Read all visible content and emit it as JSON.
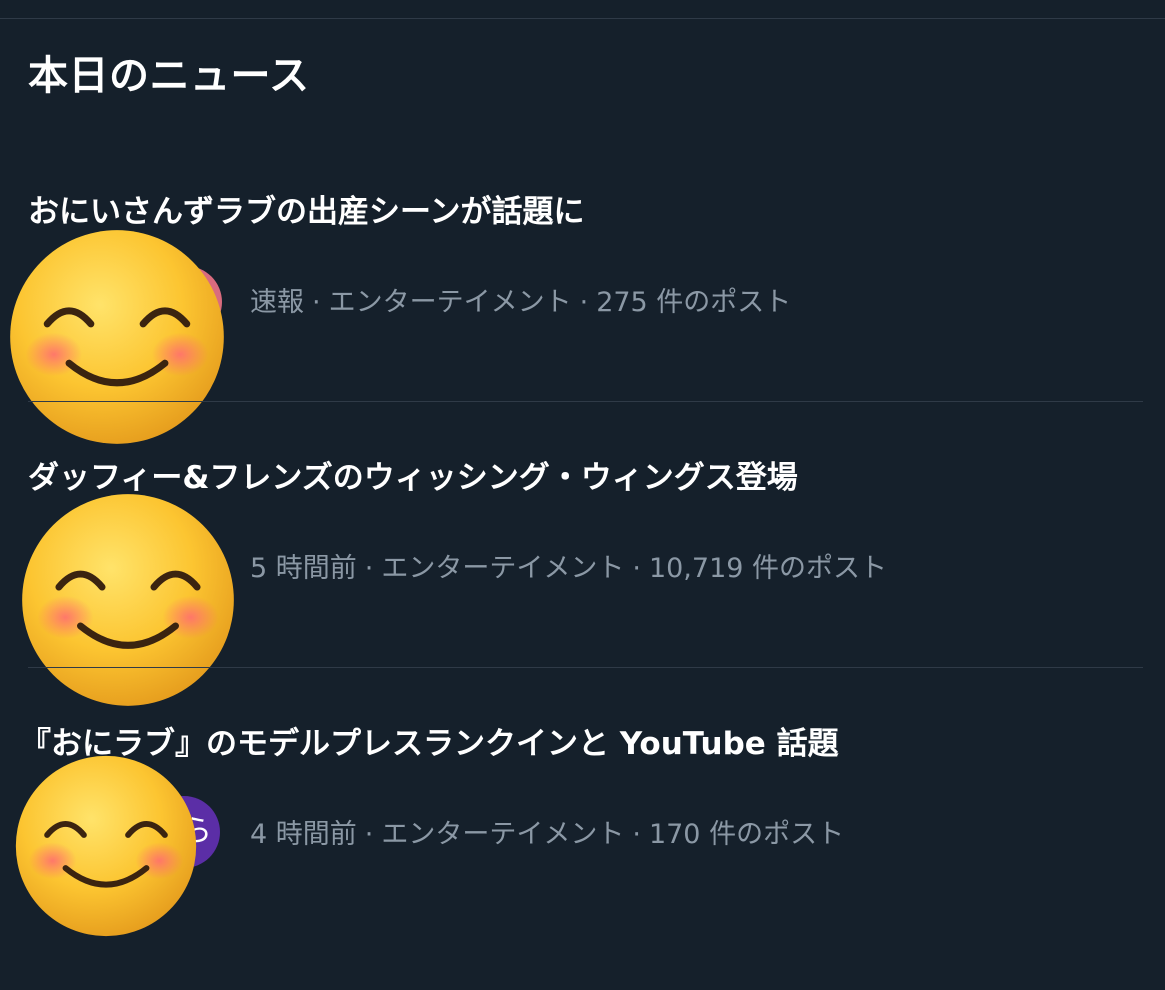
{
  "section": {
    "title": "本日のニュース"
  },
  "news": [
    {
      "headline": "おにいさんずラブの出産シーンが話題に",
      "time": "速報",
      "category": "エンターテイメント",
      "posts": "275 件のポスト"
    },
    {
      "headline": "ダッフィー&フレンズのウィッシング・ウィングス登場",
      "time": "5 時間前",
      "category": "エンターテイメント",
      "posts": "10,719 件のポスト"
    },
    {
      "headline": "『おにラブ』のモデルプレスランクインと YouTube 話題",
      "time": "4 時間前",
      "category": "エンターテイメント",
      "posts": "170 件のポスト"
    }
  ],
  "meta_separator": "·",
  "thumb_partial_char": "ら",
  "colors": {
    "background": "#15202b",
    "divider": "#2f3a47",
    "meta_text": "#8b98a5",
    "headline_text": "#ffffff",
    "thumb3": "#5b2ea6"
  },
  "icons": {
    "overlay": "smiling-face-emoji-icon"
  }
}
